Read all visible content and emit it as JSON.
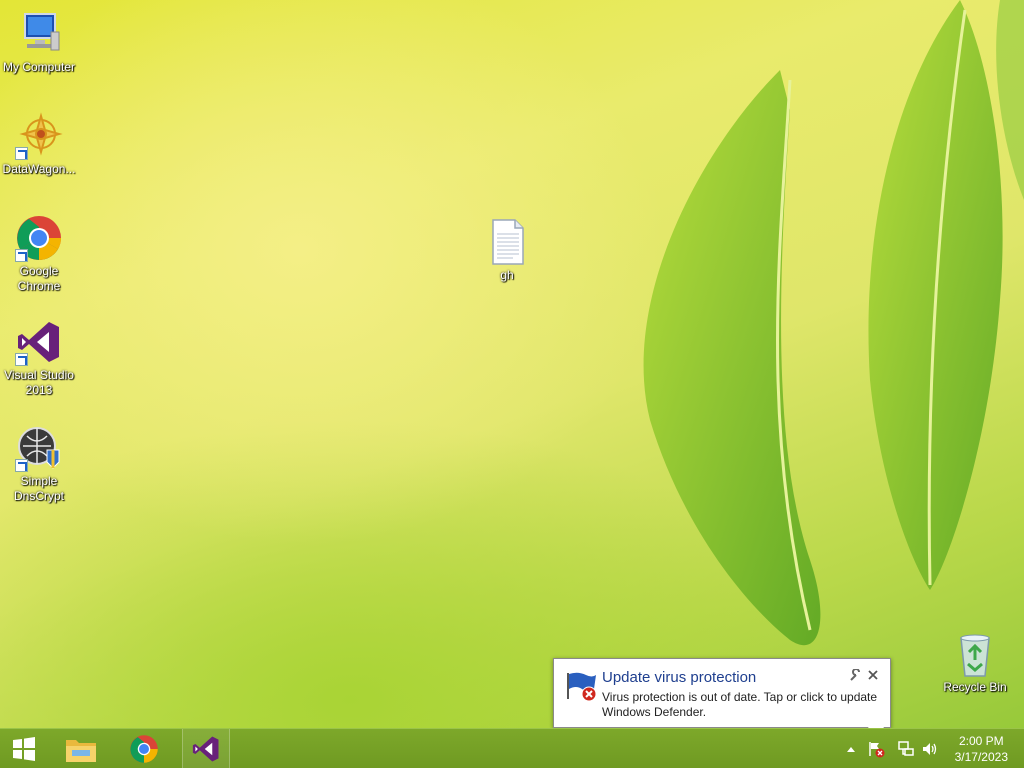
{
  "desktop": {
    "icons": [
      {
        "label": "My Computer"
      },
      {
        "label": "DataWagon..."
      },
      {
        "label": "Google Chrome"
      },
      {
        "label": "Visual Studio 2013"
      },
      {
        "label": "Simple DnsCrypt"
      },
      {
        "label": "gh"
      },
      {
        "label": "Recycle Bin"
      }
    ]
  },
  "notification": {
    "title": "Update virus protection",
    "body": "Virus protection is out of date. Tap or click to update Windows Defender."
  },
  "taskbar": {
    "clock": {
      "time": "2:00 PM",
      "date": "3/17/2023"
    }
  },
  "colors": {
    "accent": "#6f9a22",
    "toast_title": "#1f3f8f"
  }
}
